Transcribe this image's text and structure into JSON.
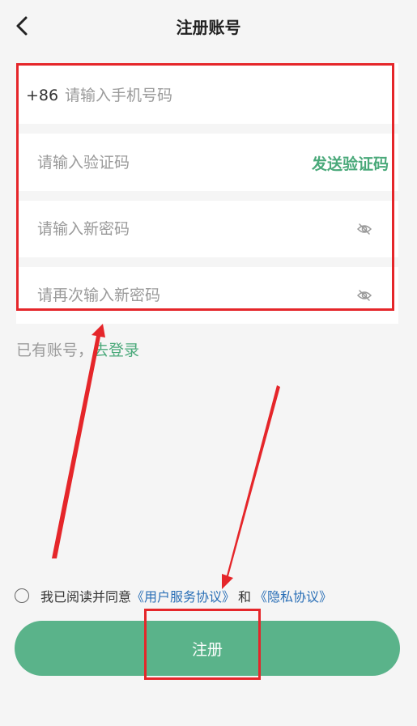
{
  "header": {
    "title": "注册账号",
    "back_icon": "chevron-left-icon"
  },
  "form": {
    "phone_prefix": "+86",
    "phone_placeholder": "请输入手机号码",
    "code_placeholder": "请输入验证码",
    "send_code_label": "发送验证码",
    "new_password_placeholder": "请输入新密码",
    "confirm_password_placeholder": "请再次输入新密码",
    "password_toggle_icon": "eye-hidden-icon"
  },
  "login": {
    "prefix": "已有账号，",
    "link": "去登录"
  },
  "agreement": {
    "text": "我已阅读并同意",
    "user_agreement": "《用户服务协议》",
    "and": "和",
    "privacy": "《隐私协议》"
  },
  "register_button": {
    "label": "注册"
  },
  "colors": {
    "accent_green": "#4aa97a",
    "button_green": "#5ab38a",
    "link_blue": "#2a6fb6",
    "annotation_red": "#e5262a",
    "background": "#f5f5f5"
  }
}
